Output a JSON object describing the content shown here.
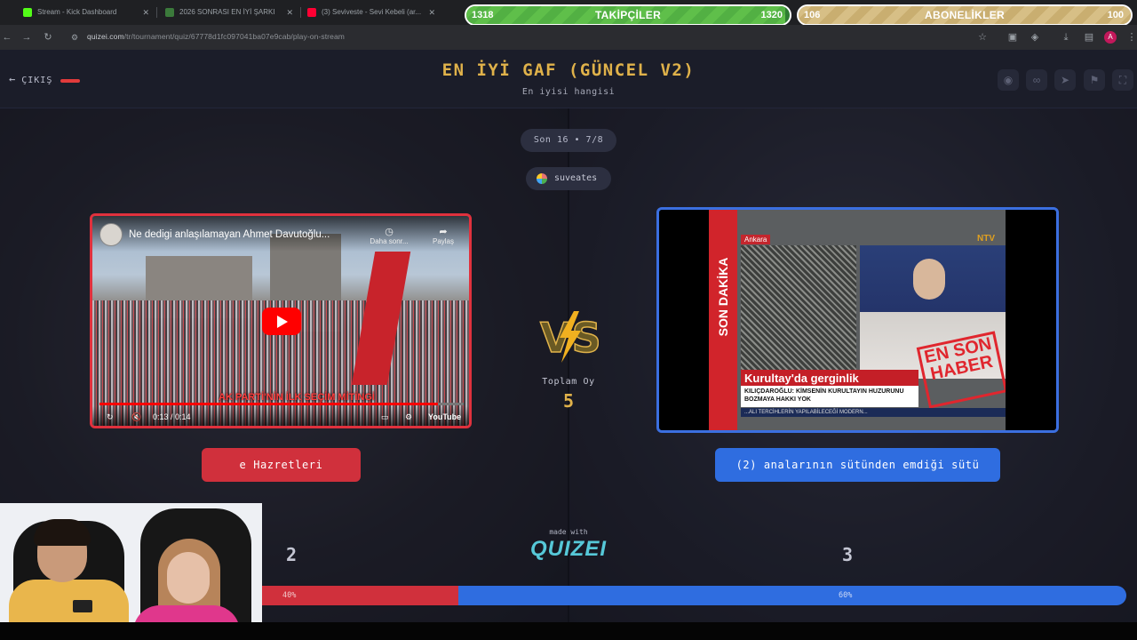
{
  "browser": {
    "tabs": [
      {
        "label": "Stream - Kick Dashboard",
        "color": "#53fc18"
      },
      {
        "label": "2026 SONRASI EN İYİ ŞARKI",
        "color": "#3b7a3b"
      },
      {
        "label": "(3) Seviveste - Sevi Kebeli (ar...",
        "color": "#ff0033"
      }
    ],
    "url_domain": "quizei.com",
    "url_path": "/tr/tournament/quiz/67778d1fc097041ba07e9cab/play-on-stream"
  },
  "goals": {
    "followers": {
      "label": "TAKİPÇİLER",
      "current": "1318",
      "target": "1320",
      "progress": 0.985
    },
    "subscribers": {
      "label": "ABONELİKLER",
      "current": "106",
      "target": "100",
      "progress": 1.0
    }
  },
  "header": {
    "exit_label": "ÇIKIŞ",
    "title": "EN İYİ GAF (GÜNCEL V2)",
    "subtitle": "En iyisi hangisi",
    "icons": [
      "eye-icon",
      "link-icon",
      "send-icon",
      "flag-icon",
      "fullscreen-icon"
    ]
  },
  "round": {
    "label": "Son 16 • 7/8",
    "user": "suveates"
  },
  "left_option": {
    "video_title": "Ne dedigi anlaşılamayan Ahmet Davutoğlu...",
    "watch_later": "Daha sonr...",
    "share": "Paylaş",
    "caption": "AK PARTİ'NİN İLK SEÇİM MİTİNGİ",
    "time": "0:13 / 0:14",
    "brand": "YouTube",
    "video_progress": 0.93,
    "button_label": "e Hazretleri",
    "votes": "2",
    "percent": "40%",
    "fraction": 0.4
  },
  "right_option": {
    "news_ticker_left": "SON DAKİKA",
    "location": "Ankara",
    "channel": "NTV",
    "headline": "Kurultay'da gerginlik",
    "subline": "KILIÇDAROĞLU: KİMSENİN KURULTAYIN HUZURUNU BOZMAYA HAKKI YOK",
    "ticker": "...ALI TERCİHLERİN YAPILABİLECEĞİ MODERN...",
    "stamp": "EN SON HABER",
    "button_label": "(2) analarının sütünden emdiği sütü",
    "votes": "3",
    "percent": "60%"
  },
  "center": {
    "total_label": "Toplam Oy",
    "total_value": "5",
    "made_with": "made with",
    "brand": "QUIZEI"
  }
}
